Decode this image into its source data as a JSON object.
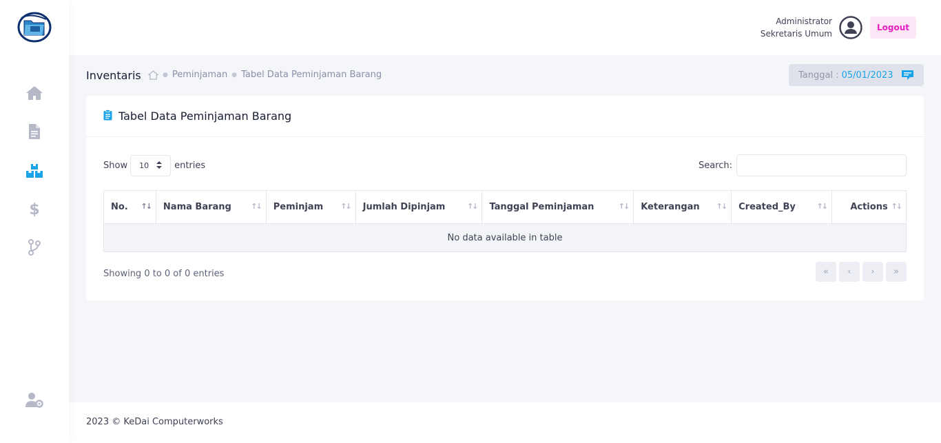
{
  "header": {
    "user_name": "Administrator",
    "user_role": "Sekretaris Umum",
    "logout_label": "Logout"
  },
  "sidebar": {
    "items": [
      {
        "icon": "home-icon",
        "active": false
      },
      {
        "icon": "document-icon",
        "active": false
      },
      {
        "icon": "boxes-icon",
        "active": true
      },
      {
        "icon": "dollar-icon",
        "active": false
      },
      {
        "icon": "branch-icon",
        "active": false
      }
    ],
    "bottom_icon": "user-settings-icon"
  },
  "subheader": {
    "title": "Inventaris",
    "breadcrumb": [
      "Peminjaman",
      "Tabel Data Peminjaman Barang"
    ],
    "date_label": "Tanggal :",
    "date_value": "05/01/2023"
  },
  "card": {
    "title": "Tabel Data Peminjaman Barang",
    "show_label": "Show",
    "entries_value": "10",
    "entries_label": "entries",
    "search_label": "Search:",
    "search_value": "",
    "columns": [
      "No.",
      "Nama Barang",
      "Peminjam",
      "Jumlah Dipinjam",
      "Tanggal Peminjaman",
      "Keterangan",
      "Created_By",
      "Actions"
    ],
    "empty_message": "No data available in table",
    "info": "Showing 0 to 0 of 0 entries"
  },
  "footer": {
    "text": "2023 © KeDai Computerworks"
  },
  "colors": {
    "accent": "#1aa3e8",
    "logout_bg": "#fde6f5",
    "logout_text": "#e91ec2",
    "icon_grey": "#b5b8c7"
  }
}
